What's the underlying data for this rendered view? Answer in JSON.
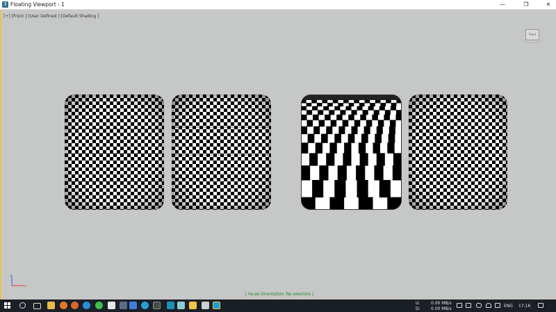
{
  "window": {
    "title": "Floating Viewport - 1",
    "minimize": "—",
    "maximize": "❐",
    "close": "✕"
  },
  "viewport": {
    "label": "[+] [Front ] [User Defined ] [Default Shading ]",
    "viewcube_label": "Front",
    "status": "[ Faces Orientation: No selection ]"
  },
  "taskbar": {
    "network_upload_label": "U:",
    "network_upload_value": "0.00 MB/s",
    "network_download_label": "D:",
    "network_download_value": "0.00 MB/s",
    "language": "ENG",
    "time": "17:16"
  },
  "colors": {
    "viewport_border": "#e8c34a",
    "status_text": "#1d8a2a",
    "taskbar": "#1b1f26"
  }
}
